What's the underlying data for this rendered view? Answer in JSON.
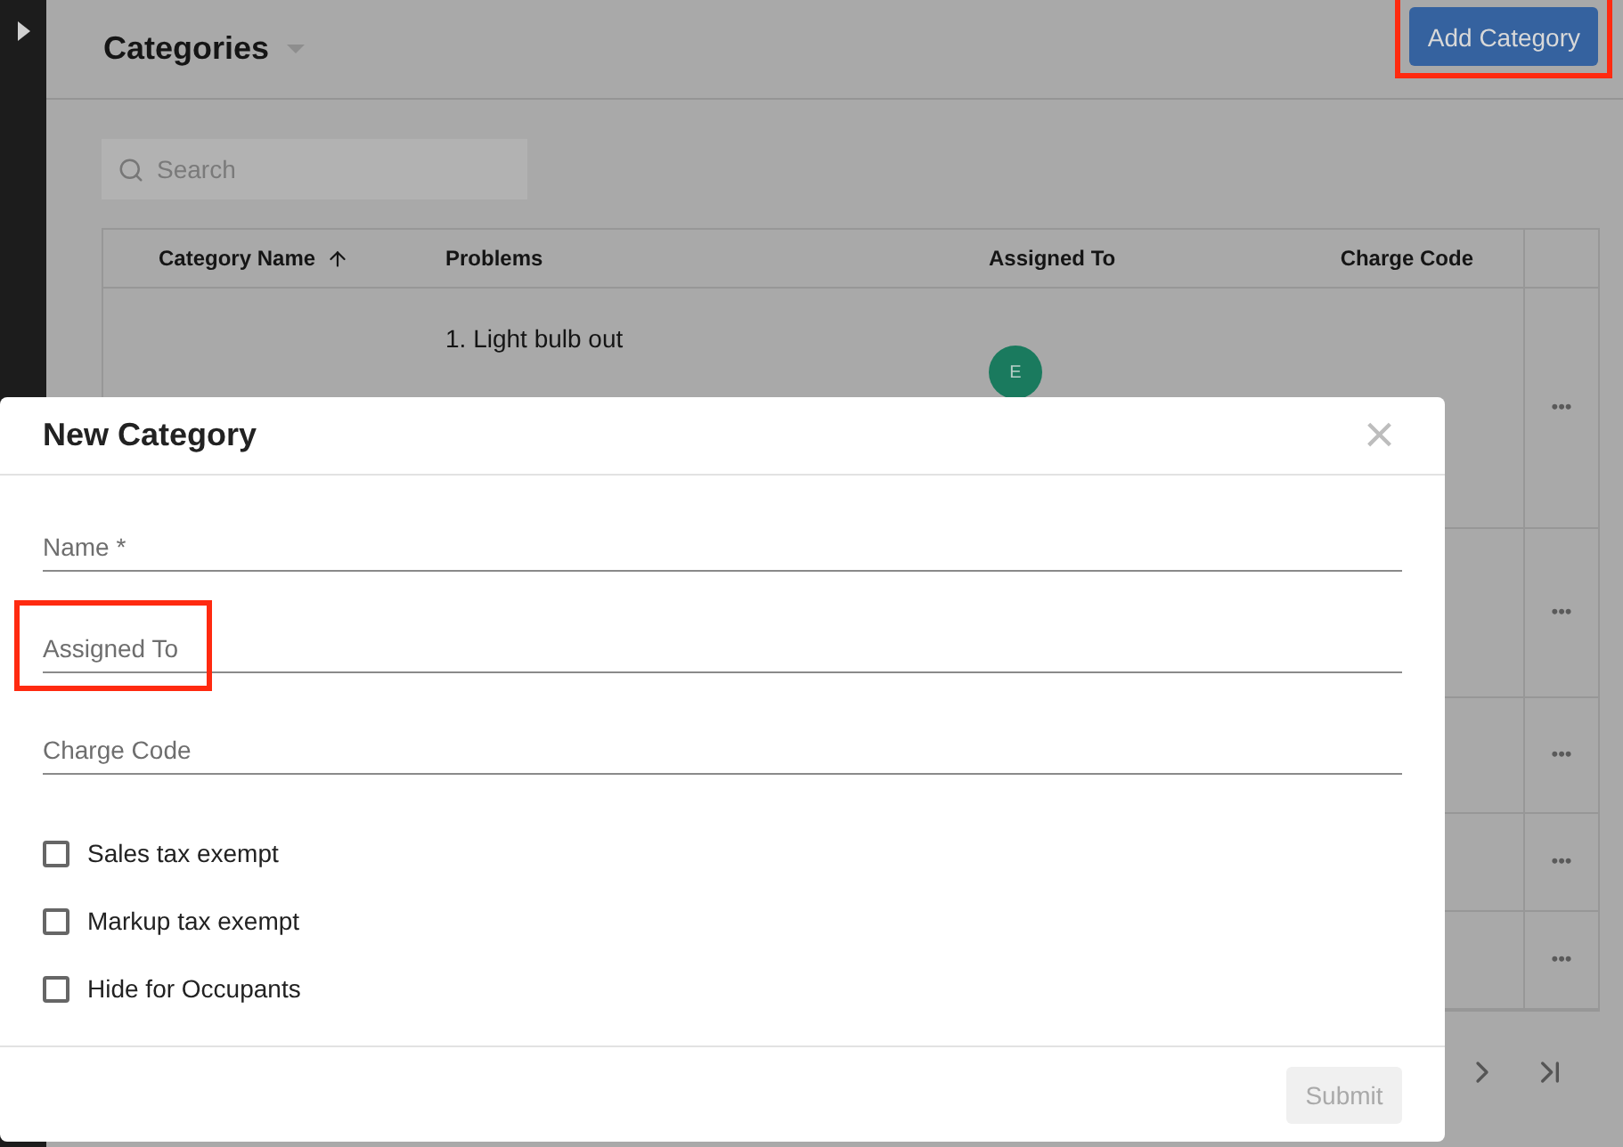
{
  "page": {
    "title": "Categories",
    "add_button": {
      "label": "Add Category",
      "highlighted": true
    },
    "search": {
      "placeholder": "Search"
    }
  },
  "table": {
    "columns": [
      {
        "label": "Category Name",
        "sort_ascending": true
      },
      {
        "label": "Problems"
      },
      {
        "label": "Assigned To"
      },
      {
        "label": "Charge Code"
      }
    ],
    "rows": [
      {
        "problems": [
          "1. Light bulb out"
        ],
        "assignee": "E",
        "menu": "•••"
      },
      {
        "menu": "•••"
      },
      {
        "menu": "•••"
      },
      {
        "menu": "•••"
      },
      {
        "menu": "•••"
      }
    ]
  },
  "dialog": {
    "title": "New Category",
    "close": "×",
    "fields": [
      {
        "placeholder": "Name *",
        "highlighted": false
      },
      {
        "placeholder": "Assigned To",
        "highlighted": true
      },
      {
        "placeholder": "Charge Code",
        "highlighted": false
      }
    ],
    "checkboxes": [
      {
        "label": "Sales tax exempt",
        "checked": false
      },
      {
        "label": "Markup tax exempt",
        "checked": false
      },
      {
        "label": "Hide for Occupants",
        "checked": false
      }
    ],
    "submit": {
      "label": "Submit",
      "disabled": true
    }
  }
}
